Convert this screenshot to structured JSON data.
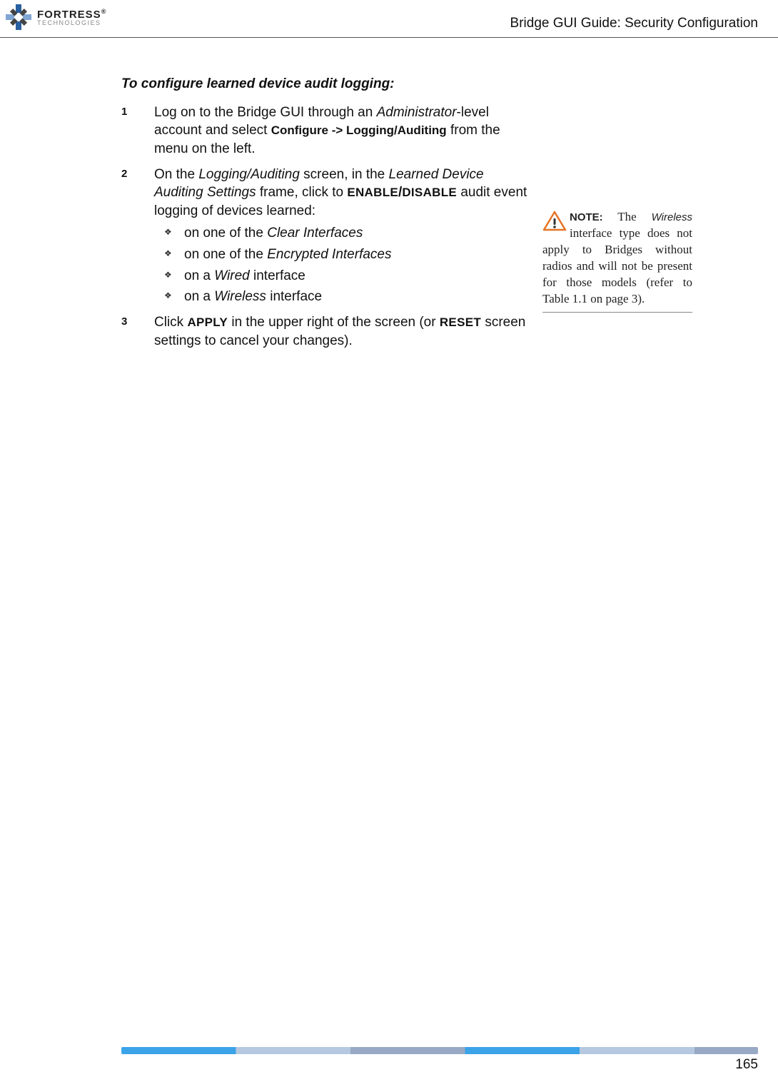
{
  "header": {
    "logo": {
      "brand": "FORTRESS",
      "sub": "TECHNOLOGIES",
      "trademark": "®"
    },
    "title": "Bridge GUI Guide: Security Configuration"
  },
  "section": {
    "heading": "To configure learned device audit logging:",
    "steps": [
      {
        "num": "1",
        "parts": [
          {
            "t": "text",
            "v": "Log on to the Bridge GUI through an "
          },
          {
            "t": "italic",
            "v": "Administrator"
          },
          {
            "t": "text",
            "v": "-level account and select "
          },
          {
            "t": "bold-sans",
            "v": "Configure -> Logging/Auditing"
          },
          {
            "t": "text",
            "v": " from the menu on the left."
          }
        ]
      },
      {
        "num": "2",
        "parts": [
          {
            "t": "text",
            "v": "On the "
          },
          {
            "t": "italic",
            "v": "Logging/Auditing"
          },
          {
            "t": "text",
            "v": " screen, in the "
          },
          {
            "t": "italic",
            "v": "Learned Device Auditing Settings"
          },
          {
            "t": "text",
            "v": " frame, click to "
          },
          {
            "t": "smallcaps",
            "v": "ENABLE"
          },
          {
            "t": "bold",
            "v": "/"
          },
          {
            "t": "smallcaps",
            "v": "DISABLE"
          },
          {
            "t": "text",
            "v": " audit event logging of devices learned:"
          }
        ],
        "sub": [
          [
            {
              "t": "text",
              "v": "on one of the "
            },
            {
              "t": "italic",
              "v": "Clear Interfaces"
            }
          ],
          [
            {
              "t": "text",
              "v": "on one of the "
            },
            {
              "t": "italic",
              "v": "Encrypted Interfaces"
            }
          ],
          [
            {
              "t": "text",
              "v": "on a "
            },
            {
              "t": "italic",
              "v": "Wired"
            },
            {
              "t": "text",
              "v": " interface"
            }
          ],
          [
            {
              "t": "text",
              "v": "on a "
            },
            {
              "t": "italic",
              "v": "Wireless"
            },
            {
              "t": "text",
              "v": " interface"
            }
          ]
        ]
      },
      {
        "num": "3",
        "parts": [
          {
            "t": "text",
            "v": "Click "
          },
          {
            "t": "smallcaps",
            "v": "APPLY"
          },
          {
            "t": "text",
            "v": " in the upper right of the screen (or "
          },
          {
            "t": "smallcaps",
            "v": "RESET"
          },
          {
            "t": "text",
            "v": " screen settings to cancel your changes)."
          }
        ]
      }
    ]
  },
  "note": {
    "label": "NOTE:",
    "parts": [
      {
        "t": "text",
        "v": " The "
      },
      {
        "t": "note-italic",
        "v": "Wire­less"
      },
      {
        "t": "text",
        "v": " interface type does not apply to Bridg­es without radios and will not be present for those models (refer to Table 1.1 on page 3)."
      }
    ]
  },
  "footer": {
    "page": "165"
  }
}
